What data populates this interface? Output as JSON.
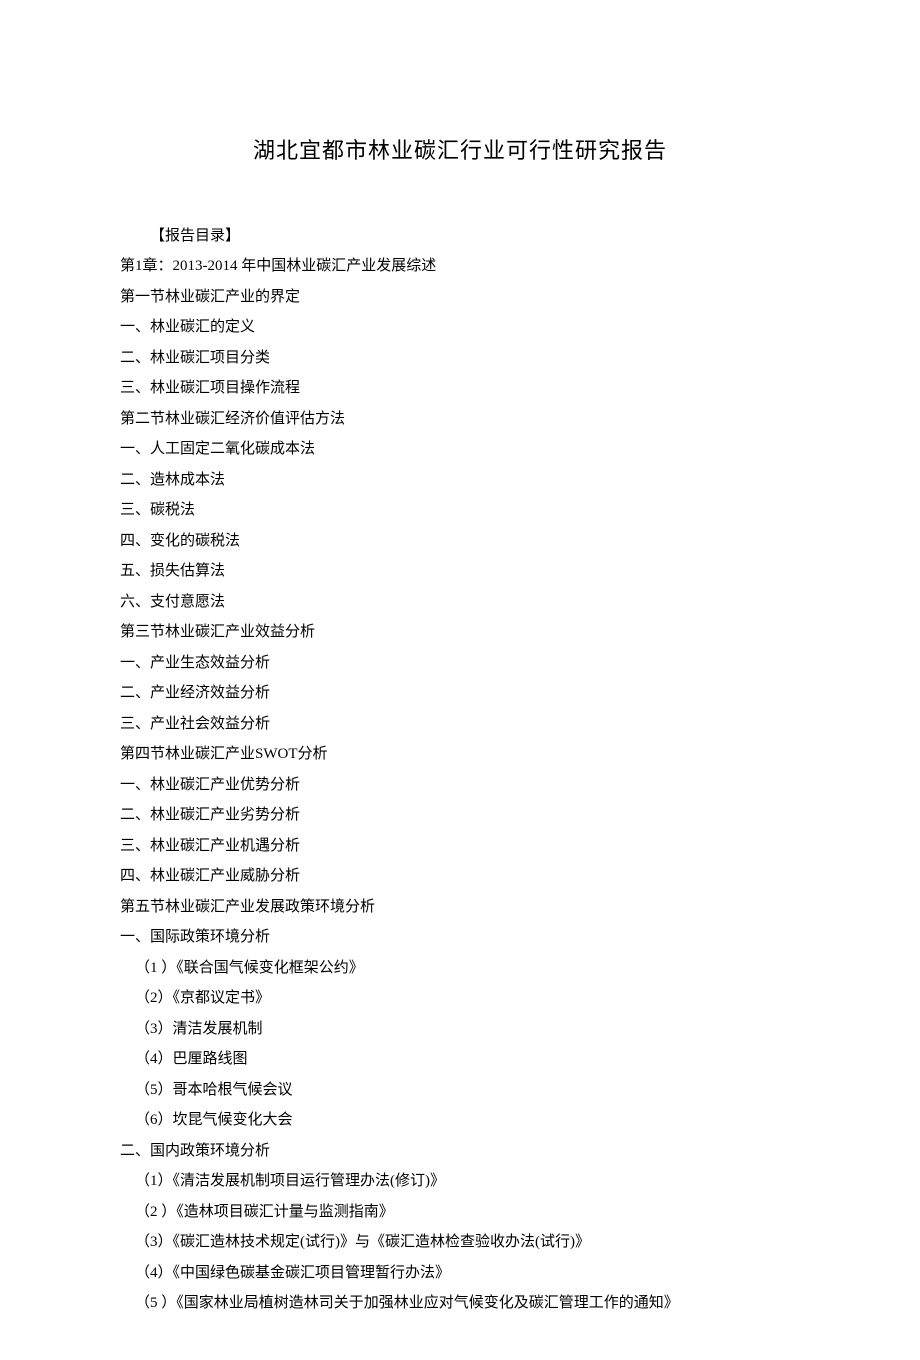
{
  "title": "湖北宜都市林业碳汇行业可行性研究报告",
  "toc_label": "【报告目录】",
  "lines": [
    "第1章：2013-2014 年中国林业碳汇产业发展综述",
    "第一节林业碳汇产业的界定",
    "一、林业碳汇的定义",
    "二、林业碳汇项目分类",
    "三、林业碳汇项目操作流程",
    "第二节林业碳汇经济价值评估方法",
    "一、人工固定二氧化碳成本法",
    "二、造林成本法",
    "三、碳税法",
    "四、变化的碳税法",
    "五、损失估算法",
    "六、支付意愿法",
    "第三节林业碳汇产业效益分析",
    "一、产业生态效益分析",
    "二、产业经济效益分析",
    "三、产业社会效益分析",
    "第四节林业碳汇产业SWOT分析",
    "一、林业碳汇产业优势分析",
    "二、林业碳汇产业劣势分析",
    "三、林业碳汇产业机遇分析",
    "四、林业碳汇产业威胁分析",
    "第五节林业碳汇产业发展政策环境分析",
    "一、国际政策环境分析"
  ],
  "sub_intl": [
    "（1 ）《联合国气候变化框架公约》",
    "（2）《京都议定书》",
    "（3）清洁发展机制",
    "（4）巴厘路线图",
    "（5）哥本哈根气候会议",
    "（6）坎昆气候变化大会"
  ],
  "domestic_header": "二、国内政策环境分析",
  "sub_dom": [
    "（1）《清洁发展机制项目运行管理办法(修订)》",
    "（2 ）《造林项目碳汇计量与监测指南》",
    "（3）《碳汇造林技术规定(试行)》与《碳汇造林检查验收办法(试行)》",
    "（4）《中国绿色碳基金碳汇项目管理暂行办法》",
    "（5 ）《国家林业局植树造林司关于加强林业应对气候变化及碳汇管理工作的通知》"
  ]
}
